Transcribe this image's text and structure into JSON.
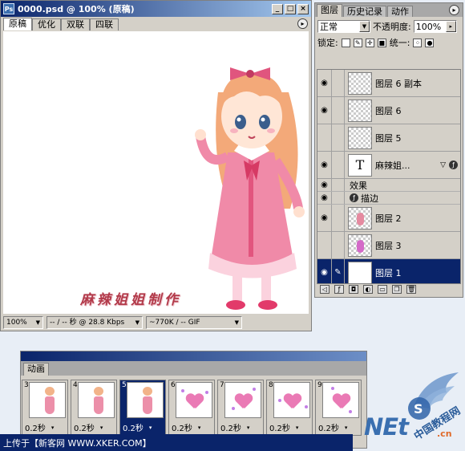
{
  "document": {
    "title": "0000.psd @ 100% (原稿)",
    "tabs": [
      "原稿",
      "优化",
      "双联",
      "四联"
    ],
    "status": {
      "zoom": "100%",
      "speed": "-- / -- 秒 @ 28.8 Kbps",
      "size": "~770K / -- GIF"
    },
    "signature": "麻辣姐姐制作"
  },
  "layers_panel": {
    "tabs": [
      "图层",
      "历史记录",
      "动作"
    ],
    "blend_mode": "正常",
    "opacity_label": "不透明度:",
    "opacity_value": "100%",
    "lock_label": "锁定:",
    "unify_label": "统一:",
    "layers": [
      {
        "name": "图层 6 副本",
        "visible": true,
        "thumb": "checker",
        "selected": false
      },
      {
        "name": "图层 6",
        "visible": true,
        "thumb": "checker",
        "selected": false
      },
      {
        "name": "图层 5",
        "visible": false,
        "thumb": "checker",
        "selected": false
      },
      {
        "name": "麻辣姐...",
        "visible": true,
        "thumb": "text",
        "selected": false
      },
      {
        "name": "图层 2",
        "visible": true,
        "thumb": "checker-girl",
        "selected": false
      },
      {
        "name": "图层 3",
        "visible": false,
        "thumb": "checker-girl",
        "selected": false
      },
      {
        "name": "图层 1",
        "visible": true,
        "thumb": "white",
        "selected": true
      }
    ],
    "text_thumb_glyph": "T",
    "effects_label": "效果",
    "stroke_label": "描边"
  },
  "animation_panel": {
    "tab": "动画",
    "frames": [
      {
        "number": "3",
        "delay": "0.2秒",
        "content": "girl",
        "selected": false
      },
      {
        "number": "4",
        "delay": "0.2秒",
        "content": "girl",
        "selected": false
      },
      {
        "number": "5",
        "delay": "0.2秒",
        "content": "girl",
        "selected": true
      },
      {
        "number": "6",
        "delay": "0.2秒",
        "content": "heart",
        "selected": false
      },
      {
        "number": "7",
        "delay": "0.2秒",
        "content": "heart",
        "selected": false
      },
      {
        "number": "8",
        "delay": "0.2秒",
        "content": "heart",
        "selected": false
      },
      {
        "number": "9",
        "delay": "0.2秒",
        "content": "heart",
        "selected": false
      }
    ]
  },
  "footer": {
    "text": "上传于【新客网 WWW.XKER.COM】"
  },
  "watermark": {
    "net": "NEt",
    "cn": ".cn",
    "site": "中国教程网"
  },
  "colors": {
    "titlebar": "#0a246a",
    "panel_bg": "#d4d0c8",
    "selection": "#0a246a",
    "signature": "#b23a4a"
  }
}
